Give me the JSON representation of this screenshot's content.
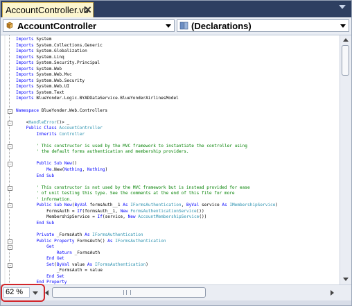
{
  "tab": {
    "title": "AccountController.vb",
    "close_glyph": "✕"
  },
  "navbar": {
    "class_combo": "AccountController",
    "member_combo": "(Declarations)"
  },
  "code_lines": [
    {
      "segs": [
        {
          "t": "Imports ",
          "c": "kw"
        },
        {
          "t": "System"
        }
      ]
    },
    {
      "segs": [
        {
          "t": "Imports ",
          "c": "kw"
        },
        {
          "t": "System.Collections.Generic"
        }
      ]
    },
    {
      "segs": [
        {
          "t": "Imports ",
          "c": "kw"
        },
        {
          "t": "System.Globalization"
        }
      ]
    },
    {
      "segs": [
        {
          "t": "Imports ",
          "c": "kw"
        },
        {
          "t": "System.Linq"
        }
      ]
    },
    {
      "segs": [
        {
          "t": "Imports ",
          "c": "kw"
        },
        {
          "t": "System.Security.Principal"
        }
      ]
    },
    {
      "segs": [
        {
          "t": "Imports ",
          "c": "kw"
        },
        {
          "t": "System.Web"
        }
      ]
    },
    {
      "segs": [
        {
          "t": "Imports ",
          "c": "kw"
        },
        {
          "t": "System.Web.Mvc"
        }
      ]
    },
    {
      "segs": [
        {
          "t": "Imports ",
          "c": "kw"
        },
        {
          "t": "System.Web.Security"
        }
      ]
    },
    {
      "segs": [
        {
          "t": "Imports ",
          "c": "kw"
        },
        {
          "t": "System.Web.UI"
        }
      ]
    },
    {
      "segs": [
        {
          "t": "Imports ",
          "c": "kw"
        },
        {
          "t": "System.Text"
        }
      ]
    },
    {
      "segs": [
        {
          "t": "Imports ",
          "c": "kw"
        },
        {
          "t": "BlueYonder.Logic.BYADOataService.BlueYonderAirlinesModel"
        }
      ]
    },
    {
      "segs": []
    },
    {
      "fold": "-",
      "segs": [
        {
          "t": "Namespace ",
          "c": "kw"
        },
        {
          "t": "BlueYonder.Web.Controllers"
        }
      ]
    },
    {
      "segs": []
    },
    {
      "fold": "-",
      "indent": "    ",
      "segs": [
        {
          "t": "<"
        },
        {
          "t": "HandleError",
          "c": "ty"
        },
        {
          "t": "()> _"
        }
      ]
    },
    {
      "indent": "    ",
      "segs": [
        {
          "t": "Public Class ",
          "c": "kw"
        },
        {
          "t": "AccountController",
          "c": "ty"
        }
      ]
    },
    {
      "indent": "        ",
      "segs": [
        {
          "t": "Inherits ",
          "c": "kw"
        },
        {
          "t": "Controller",
          "c": "ty"
        }
      ]
    },
    {
      "segs": []
    },
    {
      "fold": "-",
      "indent": "        ",
      "segs": [
        {
          "t": "' This constructor is used by the MVC framework to instantiate the controller using",
          "c": "cm"
        }
      ]
    },
    {
      "indent": "        ",
      "segs": [
        {
          "t": "' the default forms authentication and membership providers.",
          "c": "cm"
        }
      ]
    },
    {
      "segs": []
    },
    {
      "fold": "-",
      "indent": "        ",
      "segs": [
        {
          "t": "Public Sub New",
          "c": "kw"
        },
        {
          "t": "()"
        }
      ]
    },
    {
      "indent": "            ",
      "segs": [
        {
          "t": "Me",
          "c": "kw"
        },
        {
          "t": ".New("
        },
        {
          "t": "Nothing",
          "c": "kw"
        },
        {
          "t": ", "
        },
        {
          "t": "Nothing",
          "c": "kw"
        },
        {
          "t": ")"
        }
      ]
    },
    {
      "indent": "        ",
      "segs": [
        {
          "t": "End Sub",
          "c": "kw"
        }
      ]
    },
    {
      "segs": []
    },
    {
      "fold": "-",
      "indent": "        ",
      "segs": [
        {
          "t": "' This constructor is not used by the MVC framework but is instead provided for ease",
          "c": "cm"
        }
      ]
    },
    {
      "indent": "        ",
      "segs": [
        {
          "t": "' of unit testing this type. See the comments at the end of this file for more",
          "c": "cm"
        }
      ]
    },
    {
      "indent": "        ",
      "segs": [
        {
          "t": "' information.",
          "c": "cm"
        }
      ]
    },
    {
      "fold": "-",
      "indent": "        ",
      "segs": [
        {
          "t": "Public Sub New",
          "c": "kw"
        },
        {
          "t": "("
        },
        {
          "t": "ByVal ",
          "c": "kw"
        },
        {
          "t": "formsAuth__1 "
        },
        {
          "t": "As ",
          "c": "kw"
        },
        {
          "t": "IFormsAuthentication",
          "c": "ty"
        },
        {
          "t": ", "
        },
        {
          "t": "ByVal ",
          "c": "kw"
        },
        {
          "t": "service "
        },
        {
          "t": "As ",
          "c": "kw"
        },
        {
          "t": "IMembershipService",
          "c": "ty"
        },
        {
          "t": ")"
        }
      ]
    },
    {
      "indent": "            ",
      "segs": [
        {
          "t": "FormsAuth = "
        },
        {
          "t": "If",
          "c": "kw"
        },
        {
          "t": "(formsAuth__1, "
        },
        {
          "t": "New ",
          "c": "kw"
        },
        {
          "t": "FormsAuthenticationService",
          "c": "ty"
        },
        {
          "t": "())"
        }
      ]
    },
    {
      "indent": "            ",
      "segs": [
        {
          "t": "MembershipService = "
        },
        {
          "t": "If",
          "c": "kw"
        },
        {
          "t": "(service, "
        },
        {
          "t": "New ",
          "c": "kw"
        },
        {
          "t": "AccountMembershipService",
          "c": "ty"
        },
        {
          "t": "())"
        }
      ]
    },
    {
      "indent": "        ",
      "segs": [
        {
          "t": "End Sub",
          "c": "kw"
        }
      ]
    },
    {
      "segs": []
    },
    {
      "indent": "        ",
      "segs": [
        {
          "t": "Private ",
          "c": "kw"
        },
        {
          "t": "_FormsAuth "
        },
        {
          "t": "As ",
          "c": "kw"
        },
        {
          "t": "IFormsAuthentication",
          "c": "ty"
        }
      ]
    },
    {
      "fold": "-",
      "indent": "        ",
      "segs": [
        {
          "t": "Public Property ",
          "c": "kw"
        },
        {
          "t": "FormsAuth() "
        },
        {
          "t": "As ",
          "c": "kw"
        },
        {
          "t": "IFormsAuthentication",
          "c": "ty"
        }
      ]
    },
    {
      "fold": "-",
      "indent": "            ",
      "segs": [
        {
          "t": "Get",
          "c": "kw"
        }
      ]
    },
    {
      "indent": "                ",
      "segs": [
        {
          "t": "Return ",
          "c": "kw"
        },
        {
          "t": "_FormsAuth"
        }
      ]
    },
    {
      "indent": "            ",
      "segs": [
        {
          "t": "End Get",
          "c": "kw"
        }
      ]
    },
    {
      "fold": "-",
      "indent": "            ",
      "segs": [
        {
          "t": "Set",
          "c": "kw"
        },
        {
          "t": "("
        },
        {
          "t": "ByVal ",
          "c": "kw"
        },
        {
          "t": "value "
        },
        {
          "t": "As ",
          "c": "kw"
        },
        {
          "t": "IFormsAuthentication",
          "c": "ty"
        },
        {
          "t": ")"
        }
      ]
    },
    {
      "indent": "                ",
      "segs": [
        {
          "t": "_FormsAuth = value"
        }
      ]
    },
    {
      "indent": "            ",
      "segs": [
        {
          "t": "End Set",
          "c": "kw"
        }
      ]
    },
    {
      "indent": "        ",
      "segs": [
        {
          "t": "End Property",
          "c": "kw"
        }
      ]
    }
  ],
  "zoom": {
    "label": "62 %",
    "value_percent": 62
  },
  "colors": {
    "tabstrip": "#2e3f61",
    "active_tab": "#fdf6cf",
    "keyword": "#0000ff",
    "type": "#2b91af",
    "comment": "#008000",
    "highlight": "#d2252a"
  },
  "icons": {
    "class_combo": "class-icon",
    "member_combo": "declarations-icon"
  }
}
